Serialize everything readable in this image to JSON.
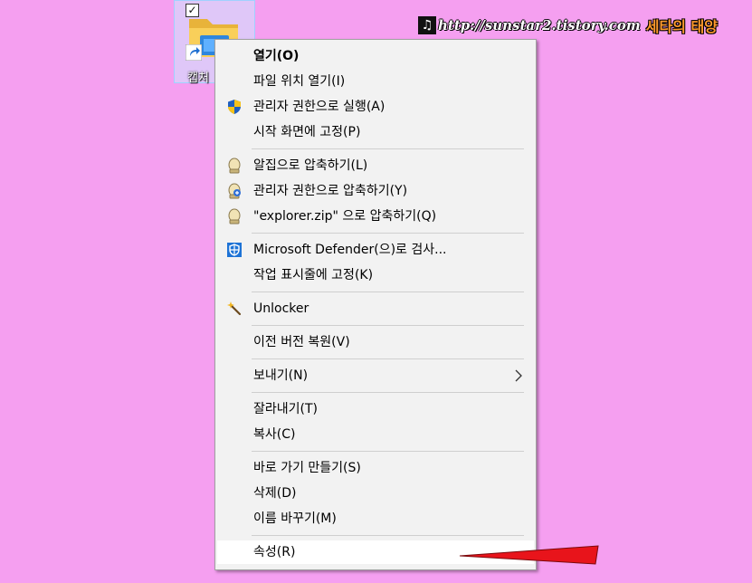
{
  "desktop": {
    "icon_label": "캡처",
    "icon_checked": true,
    "check_mark": "✓"
  },
  "watermark": {
    "url": "http://sunstar2.tistory.com",
    "name": "세타의 태양",
    "note_glyph": "♫"
  },
  "context_menu": {
    "items": [
      {
        "label": "열기(O)",
        "bold": true,
        "icon": ""
      },
      {
        "label": "파일 위치 열기(I)",
        "icon": ""
      },
      {
        "label": "관리자 권한으로 실행(A)",
        "icon": "uac-shield-icon"
      },
      {
        "label": "시작 화면에 고정(P)",
        "icon": ""
      },
      {
        "label": "알집으로 압축하기(L)",
        "icon": "alzip-icon"
      },
      {
        "label": "관리자 권한으로 압축하기(Y)",
        "icon": "alzip-admin-icon"
      },
      {
        "label": "\"explorer.zip\" 으로 압축하기(Q)",
        "icon": "alzip-icon"
      },
      {
        "label": "Microsoft Defender(으)로 검사...",
        "icon": "defender-shield-icon"
      },
      {
        "label": "작업 표시줄에 고정(K)",
        "icon": ""
      },
      {
        "label": "Unlocker",
        "icon": "unlocker-wand-icon"
      },
      {
        "label": "이전 버전 복원(V)",
        "icon": ""
      },
      {
        "label": "보내기(N)",
        "icon": "",
        "submenu": true
      },
      {
        "label": "잘라내기(T)",
        "icon": ""
      },
      {
        "label": "복사(C)",
        "icon": ""
      },
      {
        "label": "바로 가기 만들기(S)",
        "icon": ""
      },
      {
        "label": "삭제(D)",
        "icon": ""
      },
      {
        "label": "이름 바꾸기(M)",
        "icon": ""
      },
      {
        "label": "속성(R)",
        "icon": "",
        "highlighted": true
      }
    ]
  },
  "colors": {
    "desktop_background": "#f59ff0",
    "menu_background": "#f2f2f2",
    "highlight": "#ffffff",
    "pointer": "#e8141b"
  }
}
